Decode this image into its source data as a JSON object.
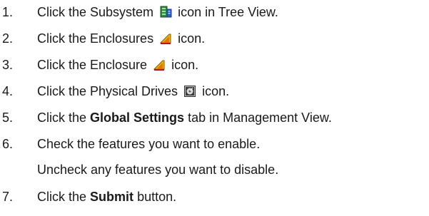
{
  "steps": [
    {
      "num": "1.",
      "before": "Click the Subsystem",
      "icon": "subsystem-icon",
      "after": "icon in Tree View."
    },
    {
      "num": "2.",
      "before": "Click the Enclosures",
      "icon": "enclosures-icon",
      "after": "icon."
    },
    {
      "num": "3.",
      "before": "Click the Enclosure",
      "icon": "enclosure-icon",
      "after": "icon."
    },
    {
      "num": "4.",
      "before": "Click the Physical Drives",
      "icon": "physical-drives-icon",
      "after": "icon."
    },
    {
      "num": "5.",
      "before": "Click the",
      "bold": "Global Settings",
      "after": "tab in Management View."
    },
    {
      "num": "6.",
      "line1": "Check the features you want to enable.",
      "line2": "Uncheck any features you want to disable."
    },
    {
      "num": "7.",
      "before": "Click the",
      "bold": "Submit",
      "after": "button."
    }
  ]
}
